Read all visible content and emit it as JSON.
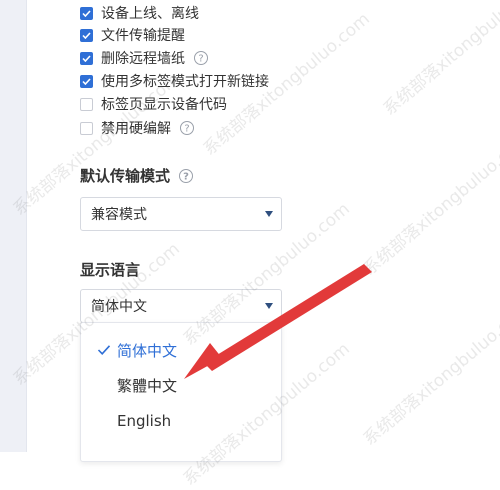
{
  "options": [
    {
      "label": "设备上线、离线",
      "checked": true,
      "help": false
    },
    {
      "label": "文件传输提醒",
      "checked": true,
      "help": false
    },
    {
      "label": "删除远程墙纸",
      "checked": true,
      "help": true
    },
    {
      "label": "使用多标签模式打开新链接",
      "checked": true,
      "help": false
    },
    {
      "label": "标签页显示设备代码",
      "checked": false,
      "help": false
    },
    {
      "label": "禁用硬编解",
      "checked": false,
      "help": true
    }
  ],
  "transfer_mode": {
    "title": "默认传输模式",
    "value": "兼容模式"
  },
  "language": {
    "title": "显示语言",
    "value": "简体中文",
    "menu": [
      {
        "label": "简体中文",
        "selected": true
      },
      {
        "label": "繁體中文",
        "selected": false
      },
      {
        "label": "English",
        "selected": false
      }
    ]
  },
  "watermark": {
    "text": "系统部落xitongbuluo.com"
  },
  "colors": {
    "accent": "#2f6fd6",
    "annotation": "#e23a3a"
  }
}
